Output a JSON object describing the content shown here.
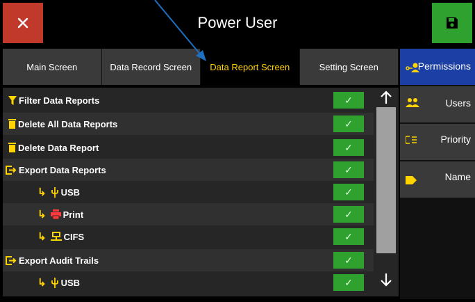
{
  "header": {
    "title": "Power User",
    "close_icon": "close-icon",
    "save_icon": "save-icon",
    "colors": {
      "close": "#c0392b",
      "save": "#2ea12e",
      "accent": "#ffd400"
    }
  },
  "tabs": [
    {
      "label": "Main Screen",
      "active": false
    },
    {
      "label": "Data Record Screen",
      "active": false
    },
    {
      "label": "Data Report Screen",
      "active": true
    },
    {
      "label": "Setting Screen",
      "active": false
    }
  ],
  "rows": [
    {
      "label": "Filter Data Reports",
      "icon": "filter-icon",
      "sub": false,
      "checked": true
    },
    {
      "label": "Delete All Data Reports",
      "icon": "trash-icon",
      "sub": false,
      "checked": true
    },
    {
      "label": "Delete Data Report",
      "icon": "trash-icon",
      "sub": false,
      "checked": true
    },
    {
      "label": "Export Data Reports",
      "icon": "export-icon",
      "sub": false,
      "checked": true
    },
    {
      "label": "USB",
      "icon": "usb-icon",
      "sub": true,
      "checked": true
    },
    {
      "label": "Print",
      "icon": "printer-icon",
      "sub": true,
      "checked": true
    },
    {
      "label": "CIFS",
      "icon": "network-icon",
      "sub": true,
      "checked": true
    },
    {
      "label": "Export Audit Trails",
      "icon": "export-icon",
      "sub": false,
      "checked": true
    },
    {
      "label": "USB",
      "icon": "usb-icon",
      "sub": true,
      "checked": true
    }
  ],
  "side_menu": [
    {
      "label": "Permissions",
      "icon": "user-key-icon",
      "active": true
    },
    {
      "label": "Users",
      "icon": "users-icon",
      "active": false
    },
    {
      "label": "Priority",
      "icon": "priority-icon",
      "active": false
    },
    {
      "label": "Name",
      "icon": "tag-icon",
      "active": false
    }
  ]
}
